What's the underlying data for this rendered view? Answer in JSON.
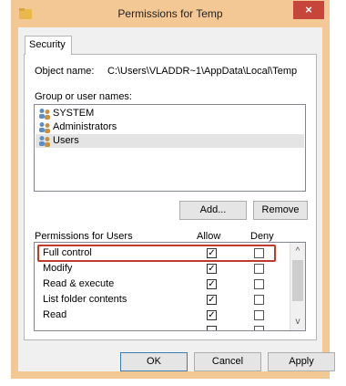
{
  "window": {
    "title": "Permissions for Temp",
    "close_glyph": "×"
  },
  "tabs": [
    {
      "label": "Security"
    }
  ],
  "object": {
    "label": "Object name:",
    "value": "C:\\Users\\VLADDR~1\\AppData\\Local\\Temp"
  },
  "groups": {
    "label": "Group or user names:",
    "items": [
      {
        "name": "SYSTEM",
        "icon": "users-icon",
        "selected": false
      },
      {
        "name": "Administrators",
        "icon": "users-icon",
        "selected": false
      },
      {
        "name": "Users",
        "icon": "users-icon",
        "selected": true
      }
    ],
    "add_label": "Add...",
    "remove_label": "Remove"
  },
  "permissions": {
    "label": "Permissions for Users",
    "allow_header": "Allow",
    "deny_header": "Deny",
    "rows": [
      {
        "name": "Full control",
        "allow": true,
        "deny": false
      },
      {
        "name": "Modify",
        "allow": true,
        "deny": false
      },
      {
        "name": "Read & execute",
        "allow": true,
        "deny": false
      },
      {
        "name": "List folder contents",
        "allow": true,
        "deny": false
      },
      {
        "name": "Read",
        "allow": true,
        "deny": false
      }
    ],
    "highlight_color": "#c0392b"
  },
  "footer": {
    "ok_label": "OK",
    "cancel_label": "Cancel",
    "apply_label": "Apply"
  },
  "colors": {
    "title_bar": "#f4c894",
    "close_button": "#c7463b",
    "dialog_background": "#f0f0f0"
  }
}
